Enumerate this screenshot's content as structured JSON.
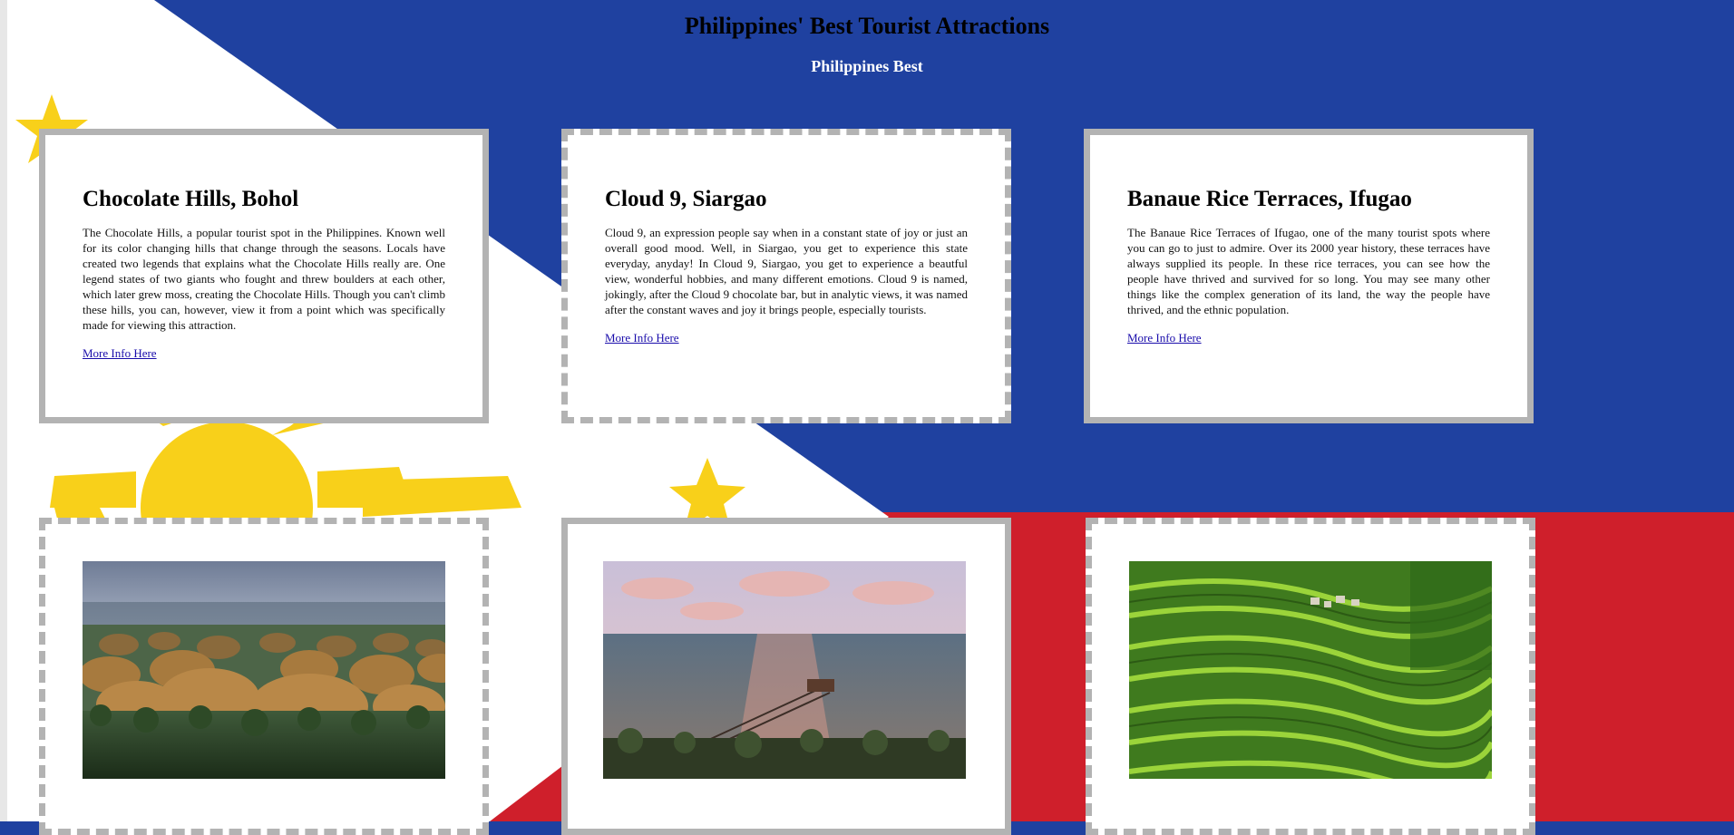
{
  "header": {
    "title": "Philippines' Best Tourist Attractions",
    "subtitle": "Philippines Best"
  },
  "colors": {
    "flag_blue": "#1f41a0",
    "flag_red": "#cf1f2b",
    "flag_white": "#ffffff",
    "flag_yellow": "#f8d01a",
    "card_border": "#b3b3b3",
    "link": "#1a0dab"
  },
  "attractions": [
    {
      "name": "Chocolate Hills, Bohol",
      "description": "The Chocolate Hills, a popular tourist spot in the Philippines. Known well for its color changing hills that change through the seasons. Locals have created two legends that explains what the Chocolate Hills really are. One legend states of two giants who fought and threw boulders at each other, which later grew moss, creating the Chocolate Hills. Though you can't climb these hills, you can, however, view it from a point which was specifically made for viewing this attraction.",
      "link_text": "More Info Here",
      "image": "chocolate-hills-photo"
    },
    {
      "name": "Cloud 9, Siargao",
      "description": "Cloud 9, an expression people say when in a constant state of joy or just an overall good mood. Well, in Siargao, you get to experience this state everyday, anyday! In Cloud 9, Siargao, you get to experience a beautful view, wonderful hobbies, and many different emotions. Cloud 9 is named, jokingly, after the Cloud 9 chocolate bar, but in analytic views, it was named after the constant waves and joy it brings people, especially tourists.",
      "link_text": "More Info Here",
      "image": "cloud-9-siargao-photo"
    },
    {
      "name": "Banaue Rice Terraces, Ifugao",
      "description": "The Banaue Rice Terraces of Ifugao, one of the many tourist spots where you can go to just to admire. Over its 2000 year history, these terraces have always supplied its people. In these rice terraces, you can see how the people have thrived and survived for so long. You may see many other things like the complex generation of its land, the way the people have thrived, and the ethnic population.",
      "link_text": "More Info Here",
      "image": "banaue-rice-terraces-photo"
    }
  ]
}
